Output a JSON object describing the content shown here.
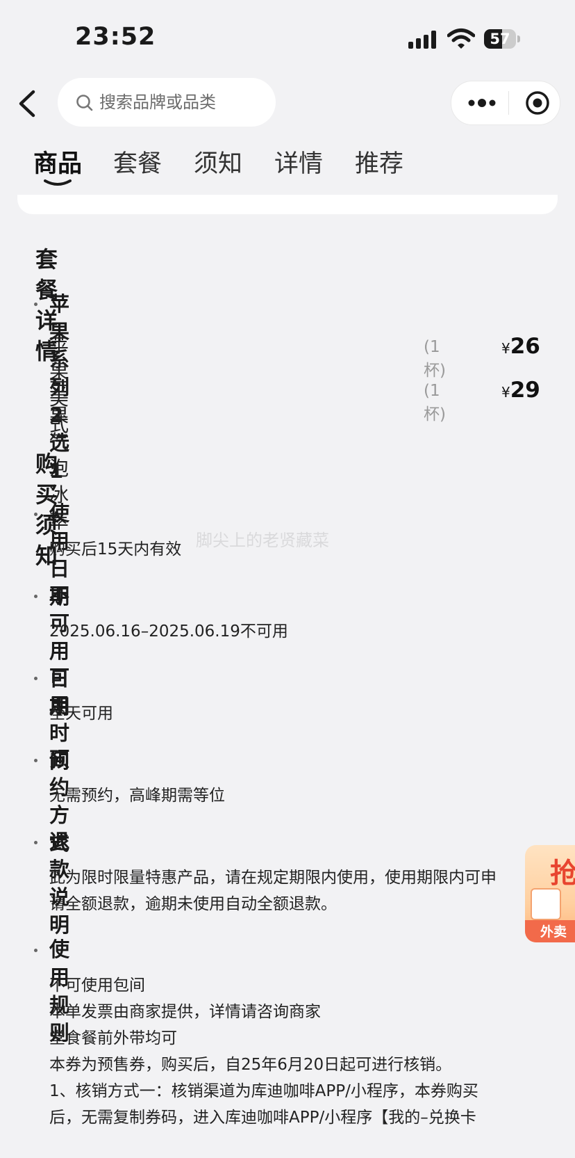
{
  "status_bar": {
    "time": "23:52",
    "battery": "57",
    "battery_level": 0.57
  },
  "nav": {
    "search_placeholder": "搜索品牌或品类"
  },
  "tabs": [
    {
      "label": "商品",
      "active": true
    },
    {
      "label": "套餐",
      "active": false
    },
    {
      "label": "须知",
      "active": false
    },
    {
      "label": "详情",
      "active": false
    },
    {
      "label": "推荐",
      "active": false
    }
  ],
  "package": {
    "title": "套餐详情",
    "group": "苹果系列 2 选 1",
    "items": [
      {
        "name": "苹果美式",
        "qty": "(1 杯)",
        "currency": "¥",
        "price": "26"
      },
      {
        "name": "苹果气泡冰萃",
        "qty": "(1 杯)",
        "currency": "¥",
        "price": "29"
      }
    ]
  },
  "notice": {
    "title": "购买须知",
    "sections": [
      {
        "title": "使用日期",
        "lines": [
          "购买后15天内有效"
        ]
      },
      {
        "title": "不可用日期",
        "lines": [
          "2025.06.16–2025.06.19不可用"
        ]
      },
      {
        "title": "可用时间",
        "lines": [
          "全天可用"
        ]
      },
      {
        "title": "预约方式",
        "lines": [
          "无需预约，高峰期需等位"
        ]
      },
      {
        "title": "退款说明",
        "lines": [
          "此为限时限量特惠产品，请在规定期限内使用，使用期限内可申",
          "请全额退款，逾期未使用自动全额退款。"
        ]
      },
      {
        "title": "使用规则",
        "lines": [
          "不可使用包间",
          "本单发票由商家提供，详情请咨询商家",
          "堂食餐前外带均可",
          "本券为预售券，购买后，自25年6月20日起可进行核销。",
          "1、核销方式一：核销渠道为库迪咖啡APP/小程序，本券购买",
          "后，无需复制券码，进入库迪咖啡APP/小程序【我的–兑换卡"
        ]
      }
    ]
  },
  "watermark": "脚尖上的老贤藏菜",
  "promo": {
    "big_text": "抢",
    "tag": "外卖"
  }
}
